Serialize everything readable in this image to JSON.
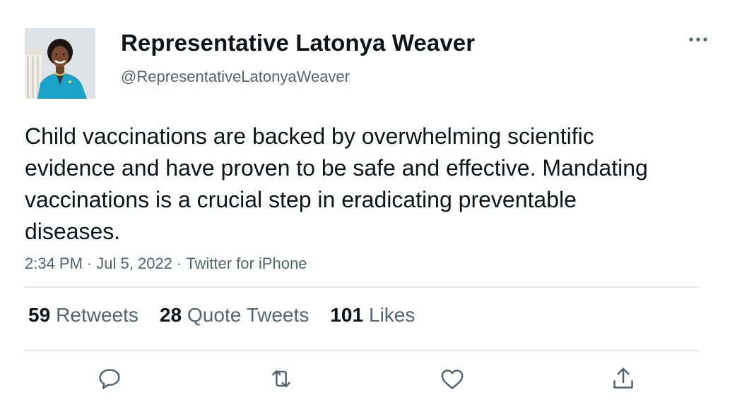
{
  "author": {
    "display_name": "Representative Latonya Weaver",
    "handle": "@RepresentativeLatonyaWeaver",
    "avatar_icon": "profile-photo"
  },
  "tweet": {
    "text": "Child vaccinations are backed by overwhelming scientific evidence and have proven to be safe and effective. Mandating vaccinations is a crucial step in eradicating preventable diseases.",
    "time": "2:34 PM",
    "date": "Jul 5, 2022",
    "source": "Twitter for iPhone",
    "separator": "·"
  },
  "stats": {
    "retweets_count": "59",
    "retweets_label": "Retweets",
    "quotes_count": "28",
    "quotes_label": "Quote Tweets",
    "likes_count": "101",
    "likes_label": "Likes"
  },
  "actions": {
    "icons": [
      "reply-icon",
      "retweet-icon",
      "like-icon",
      "share-icon"
    ]
  },
  "colors": {
    "text": "#0f1419",
    "secondary": "#536471",
    "divider": "#e3e7ea",
    "avatar_jacket": "#1aa3c8"
  }
}
